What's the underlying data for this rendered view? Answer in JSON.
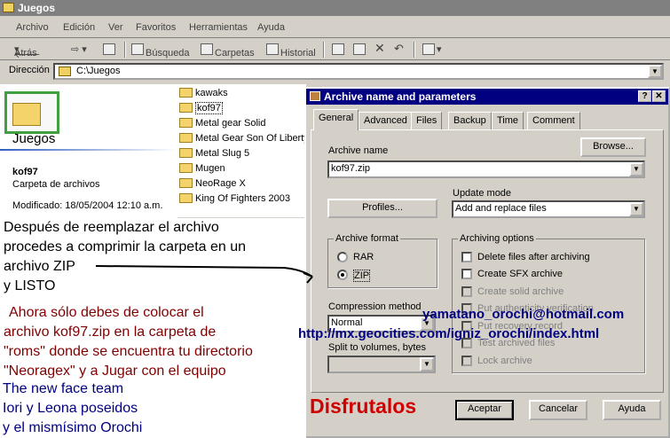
{
  "window": {
    "title": "Juegos"
  },
  "menu": [
    "Archivo",
    "Edición",
    "Ver",
    "Favoritos",
    "Herramientas",
    "Ayuda"
  ],
  "toolbar": {
    "back": "Atrás",
    "search": "Búsqueda",
    "folders": "Carpetas",
    "history": "Historial"
  },
  "address": {
    "label": "Dirección",
    "value": "C:\\Juegos"
  },
  "folder_panel": {
    "title": "Juegos",
    "selected_name": "kof97",
    "selected_type": "Carpeta de archivos",
    "modified": "Modificado: 18/05/2004 12:10 a.m."
  },
  "files": [
    "kawaks",
    "kof97",
    "Metal gear Solid",
    "Metal Gear Son Of Liberty",
    "Metal Slug 5",
    "Mugen",
    "NeoRage X",
    "King Of Fighters 2003"
  ],
  "annotations": {
    "instr1": [
      "Después de reemplazar el archivo",
      "procedes a comprimir la carpeta en un",
      "archivo ZIP",
      "y LISTO"
    ],
    "instr2": [
      "Ahora sólo debes de colocar el",
      "archivo kof97.zip en la carpeta de",
      "\"roms\" donde se encuentra tu directorio",
      "\"Neoragex\" y a Jugar con el equipo"
    ],
    "team": [
      "The new face team",
      "Iori y Leona poseidos",
      "y el mismísimo Orochi"
    ],
    "email": "yamatano_orochi@hotmail.com",
    "url": "http://mx.geocities.com/igniz_orochi/index.html",
    "enjoy": "Disfrutalos"
  },
  "dialog": {
    "title": "Archive name and parameters",
    "help_btn": "?",
    "close_btn": "✕",
    "tabs": [
      "General",
      "Advanced",
      "Files",
      "Backup",
      "Time",
      "Comment"
    ],
    "archive_name_label": "Archive name",
    "archive_name_value": "kof97.zip",
    "browse": "Browse...",
    "update_mode_label": "Update mode",
    "update_mode_value": "Add and replace files",
    "profiles": "Profiles...",
    "format_label": "Archive format",
    "format_rar": "RAR",
    "format_zip": "ZIP",
    "options_label": "Archiving options",
    "options": [
      {
        "label": "Delete files after archiving",
        "enabled": true
      },
      {
        "label": "Create SFX archive",
        "enabled": true
      },
      {
        "label": "Create solid archive",
        "enabled": false
      },
      {
        "label": "Put authenticity verification",
        "enabled": false
      },
      {
        "label": "Put recovery record",
        "enabled": false
      },
      {
        "label": "Test archived files",
        "enabled": false
      },
      {
        "label": "Lock archive",
        "enabled": false
      }
    ],
    "compression_label": "Compression method",
    "compression_value": "Normal",
    "split_label": "Split to volumes, bytes",
    "ok": "Aceptar",
    "cancel": "Cancelar",
    "help": "Ayuda"
  },
  "colors": {
    "dialog_title": "#000080",
    "instr1": "#000000",
    "instr2": "#800000",
    "team": "#000080",
    "email": "#000080",
    "enjoy": "#d00000"
  }
}
